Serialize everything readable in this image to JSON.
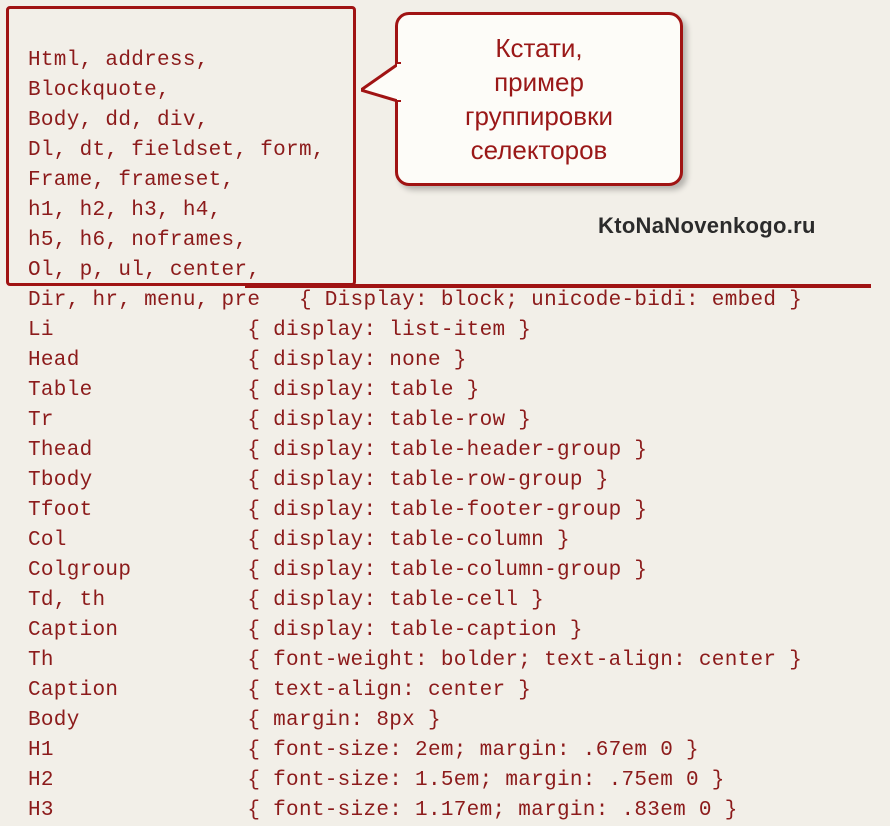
{
  "code": {
    "grouped_selectors": "Html, address,\nBlockquote,\nBody, dd, div,\nDl, dt, fieldset, form,\nFrame, frameset,\nh1, h2, h3, h4,\nh5, h6, noframes,\nOl, p, ul, center,\nDir, hr, menu, pre   { Display: block; unicode-bidi: embed }",
    "rules": [
      "Li               { display: list-item }",
      "Head             { display: none }",
      "Table            { display: table }",
      "Tr               { display: table-row }",
      "Thead            { display: table-header-group }",
      "Tbody            { display: table-row-group }",
      "Tfoot            { display: table-footer-group }",
      "Col              { display: table-column }",
      "Colgroup         { display: table-column-group }",
      "Td, th           { display: table-cell }",
      "Caption          { display: table-caption }",
      "Th               { font-weight: bolder; text-align: center }",
      "Caption          { text-align: center }",
      "Body             { margin: 8px }",
      "H1               { font-size: 2em; margin: .67em 0 }",
      "H2               { font-size: 1.5em; margin: .75em 0 }",
      "H3               { font-size: 1.17em; margin: .83em 0 }"
    ]
  },
  "callout": {
    "line1": "Кстати,",
    "line2": "пример",
    "line3": "группировки",
    "line4": "селекторов"
  },
  "domain": "KtoNaNovenkogo.ru"
}
